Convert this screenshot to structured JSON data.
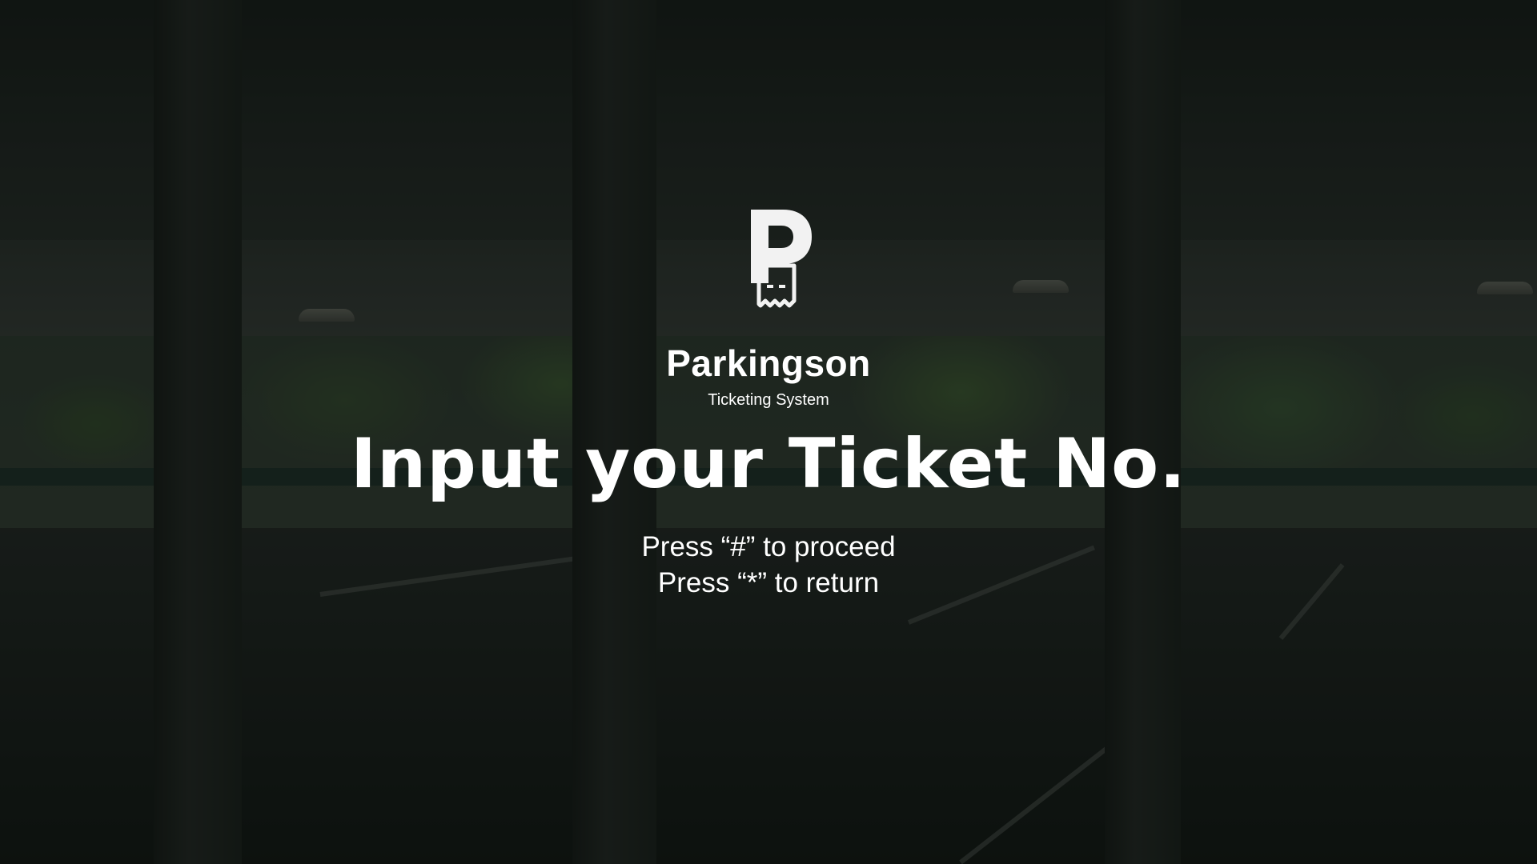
{
  "app": {
    "brand_name": "Parkingson",
    "brand_subtitle": "Ticketing System",
    "logo_icon": "parking-ticket-icon"
  },
  "screen": {
    "headline": "Input your Ticket No.",
    "instructions": [
      "Press “#” to proceed",
      "Press “*” to return"
    ]
  },
  "theme": {
    "text_color": "#ffffff",
    "overlay_color": "#080c0a"
  }
}
